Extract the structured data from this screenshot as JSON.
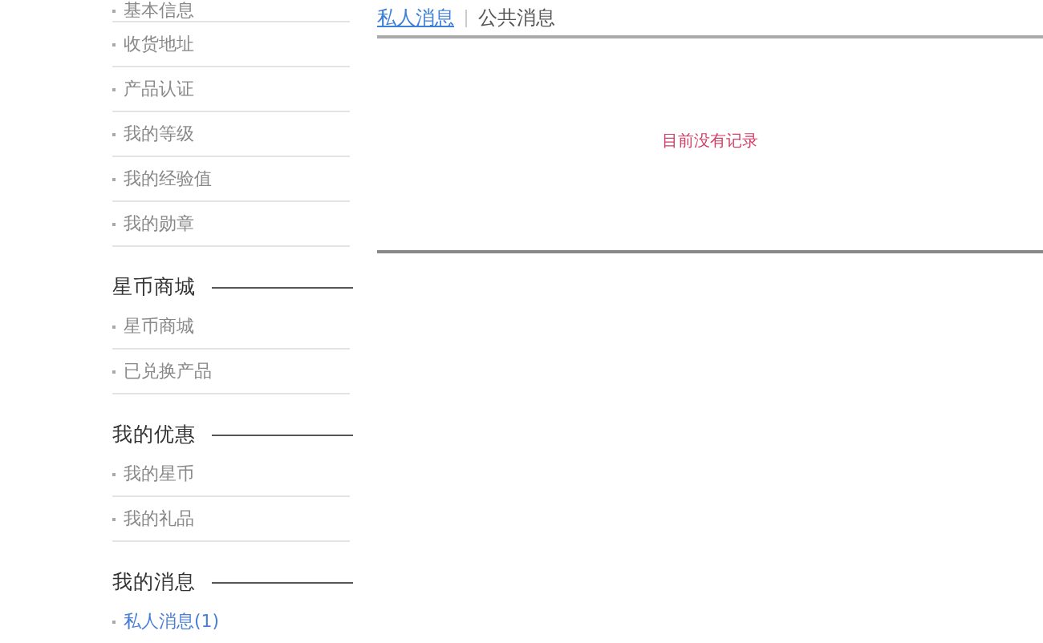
{
  "sidebar": {
    "sections": [
      {
        "items": [
          {
            "label": "基本信息",
            "selected": false
          },
          {
            "label": "收货地址",
            "selected": false
          },
          {
            "label": "产品认证",
            "selected": false
          },
          {
            "label": "我的等级",
            "selected": false
          },
          {
            "label": "我的经验值",
            "selected": false
          },
          {
            "label": "我的勋章",
            "selected": false
          }
        ]
      },
      {
        "title": "星币商城",
        "items": [
          {
            "label": "星币商城",
            "selected": false
          },
          {
            "label": "已兑换产品",
            "selected": false
          }
        ]
      },
      {
        "title": "我的优惠",
        "items": [
          {
            "label": "我的星币",
            "selected": false
          },
          {
            "label": "我的礼品",
            "selected": false
          }
        ]
      },
      {
        "title": "我的消息",
        "items": [
          {
            "label": "私人消息(1)",
            "selected": true
          }
        ]
      }
    ]
  },
  "tabs": [
    {
      "label": "私人消息",
      "selected": true
    },
    {
      "label": "公共消息",
      "selected": false
    }
  ],
  "empty_message": "目前没有记录"
}
